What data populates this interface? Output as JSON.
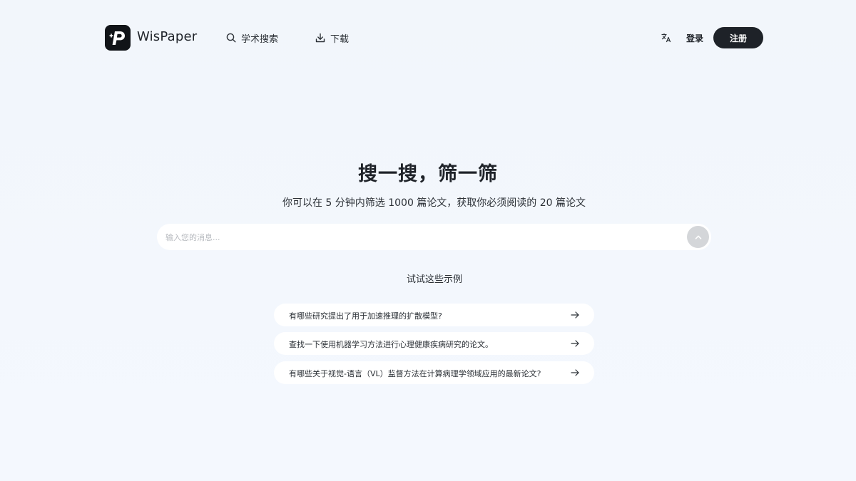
{
  "header": {
    "brand": "WisPaper",
    "nav": [
      {
        "label": "学术搜索",
        "icon": "search-icon"
      },
      {
        "label": "下载",
        "icon": "download-icon"
      }
    ],
    "language_icon": "translate-icon",
    "login_label": "登录",
    "signup_label": "注册"
  },
  "hero": {
    "title": "搜一搜，筛一筛",
    "subtitle": "你可以在 5 分钟内筛选 1000 篇论文，获取你必须阅读的 20 篇论文"
  },
  "search": {
    "placeholder": "输入您的消息...",
    "value": "",
    "send_icon": "chevron-up-icon"
  },
  "examples": {
    "label": "试试这些示例",
    "items": [
      {
        "text": "有哪些研究提出了用于加速推理的扩散模型?"
      },
      {
        "text": "查找一下使用机器学习方法进行心理健康疾病研究的论文。"
      },
      {
        "text": "有哪些关于视觉-语言（VL）监督方法在计算病理学领域应用的最新论文?"
      }
    ]
  },
  "colors": {
    "background": "#f3f7fd",
    "primary_button": "#1e2228",
    "send_button": "#d4d6d9"
  }
}
